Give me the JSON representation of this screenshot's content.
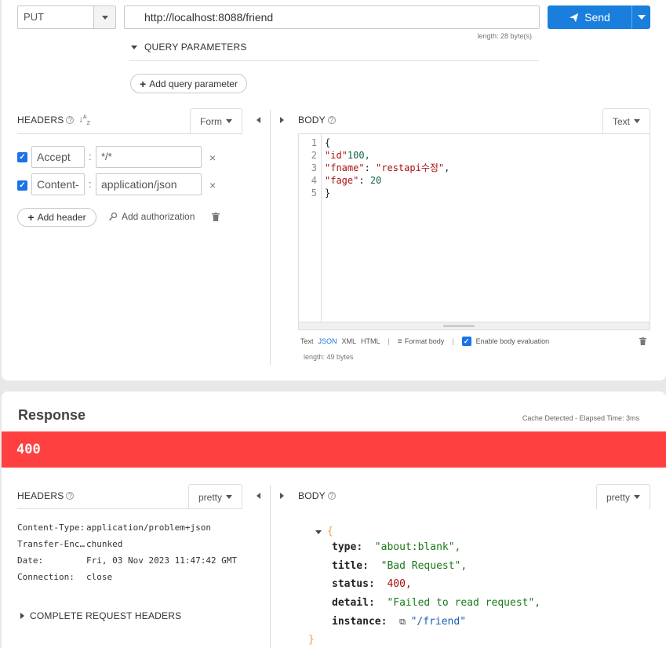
{
  "request": {
    "method": "PUT",
    "url": "http://localhost:8088/friend",
    "length_text": "length: 28 byte(s)",
    "send_label": "Send",
    "query_params_label": "QUERY PARAMETERS",
    "add_query_label": "Add query parameter"
  },
  "headers": {
    "title": "HEADERS",
    "form_label": "Form",
    "rows": [
      {
        "name": "Accept",
        "value": "*/*"
      },
      {
        "name": "Content-",
        "value": "application/json"
      }
    ],
    "add_header_label": "Add header",
    "add_auth_label": "Add authorization"
  },
  "body": {
    "title": "BODY",
    "mode_label": "Text",
    "lines": [
      {
        "num": "1",
        "parts": [
          {
            "t": "{",
            "c": "p"
          }
        ]
      },
      {
        "num": "2",
        "parts": [
          {
            "t": "\"id\"",
            "c": "k"
          },
          {
            "t": "100,",
            "c": "n"
          }
        ]
      },
      {
        "num": "3",
        "parts": [
          {
            "t": "\"fname\"",
            "c": "k"
          },
          {
            "t": ": ",
            "c": "p"
          },
          {
            "t": "\"restapi수정\"",
            "c": "s"
          },
          {
            "t": ",",
            "c": "p"
          }
        ]
      },
      {
        "num": "4",
        "parts": [
          {
            "t": "\"fage\"",
            "c": "k"
          },
          {
            "t": ": ",
            "c": "p"
          },
          {
            "t": "20",
            "c": "n"
          }
        ]
      },
      {
        "num": "5",
        "parts": [
          {
            "t": "}",
            "c": "p"
          }
        ]
      }
    ],
    "formats": [
      "Text",
      "JSON",
      "XML",
      "HTML"
    ],
    "active_format": "JSON",
    "format_body_label": "Format body",
    "enable_eval_label": "Enable body evaluation",
    "length_text": "length: 49 bytes"
  },
  "response": {
    "title": "Response",
    "cache_text": "Cache Detected - Elapsed Time: 3ms",
    "status_code": "400",
    "status_color": "#ff4040",
    "headers_title": "HEADERS",
    "headers_mode": "pretty",
    "body_title": "BODY",
    "body_mode": "pretty",
    "headers": [
      {
        "name": "Content-Type:",
        "value": "application/problem+json"
      },
      {
        "name": "Transfer-Enc…",
        "value": "chunked"
      },
      {
        "name": "Date:",
        "value": "Fri, 03 Nov 2023 11:47:42 GMT"
      },
      {
        "name": "Connection:",
        "value": "close"
      }
    ],
    "complete_headers_label": "COMPLETE REQUEST HEADERS",
    "json": [
      {
        "key": "type",
        "val": "\"about:blank\",",
        "kind": "str"
      },
      {
        "key": "title",
        "val": "\"Bad Request\",",
        "kind": "str"
      },
      {
        "key": "status",
        "val": "400,",
        "kind": "num"
      },
      {
        "key": "detail",
        "val": "\"Failed to read request\",",
        "kind": "str"
      },
      {
        "key": "instance",
        "val": "\"/friend\"",
        "kind": "link"
      }
    ],
    "open_brace": "{",
    "close_brace": "}"
  },
  "colors": {
    "accent": "#1a73e8",
    "send_bg": "#1a7fdc"
  }
}
